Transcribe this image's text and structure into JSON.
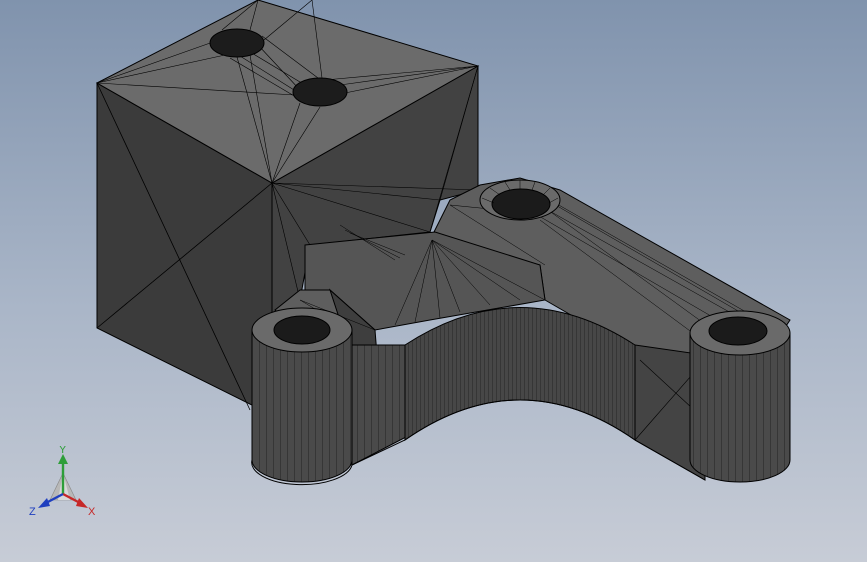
{
  "viewport": {
    "background_top": "#8093ad",
    "background_bottom": "#c7ccd6"
  },
  "model": {
    "shading": "shaded-with-edges",
    "face_dark": "#3c3c3c",
    "face_mid": "#4f4f4f",
    "face_light": "#6d6d6d",
    "edge_color": "#000000"
  },
  "triad": {
    "x_label": "X",
    "y_label": "Y",
    "z_label": "Z",
    "x_color": "#c62828",
    "y_color": "#2e9e3a",
    "z_color": "#1f3fbf"
  }
}
